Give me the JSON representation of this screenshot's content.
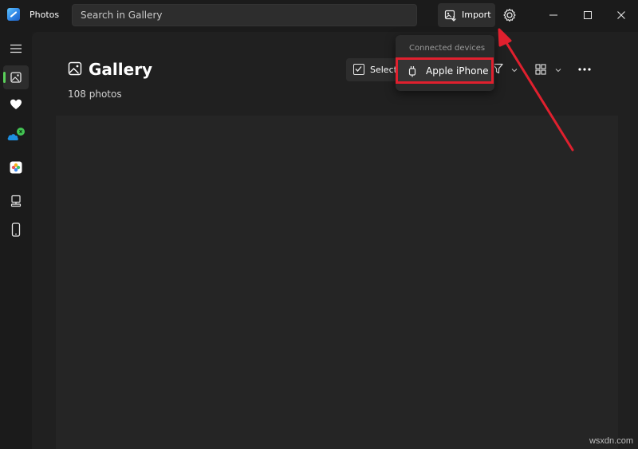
{
  "app": {
    "title": "Photos"
  },
  "search": {
    "placeholder": "Search in Gallery"
  },
  "toolbar": {
    "import_label": "Import"
  },
  "icons": {
    "app_logo": "photos-logo-icon",
    "import": "import-icon",
    "settings": "gear-icon",
    "minimize": "minimize-icon",
    "maximize": "maximize-icon",
    "close": "close-icon",
    "menu": "hamburger-icon",
    "gallery": "gallery-icon",
    "favorites": "heart-icon",
    "onedrive": "cloud-icon",
    "icloud": "icloud-photos-icon",
    "this_pc": "pc-icon",
    "phone": "phone-icon",
    "filter": "filter-icon",
    "view": "view-layout-icon",
    "more": "more-dots-icon",
    "device": "usb-device-icon"
  },
  "main": {
    "title": "Gallery",
    "photo_count": "108 photos",
    "select_label": "Select"
  },
  "dropdown": {
    "header": "Connected devices",
    "items": [
      {
        "label": "Apple iPhone",
        "highlighted": true
      }
    ]
  },
  "annotations": {
    "highlight_color": "#e0202e",
    "arrow_color": "#e0202e"
  },
  "colors": {
    "background": "#1c1c1c",
    "accent_indicator": "#5ad05a"
  },
  "watermark": {
    "text": "wsxdn.com"
  }
}
